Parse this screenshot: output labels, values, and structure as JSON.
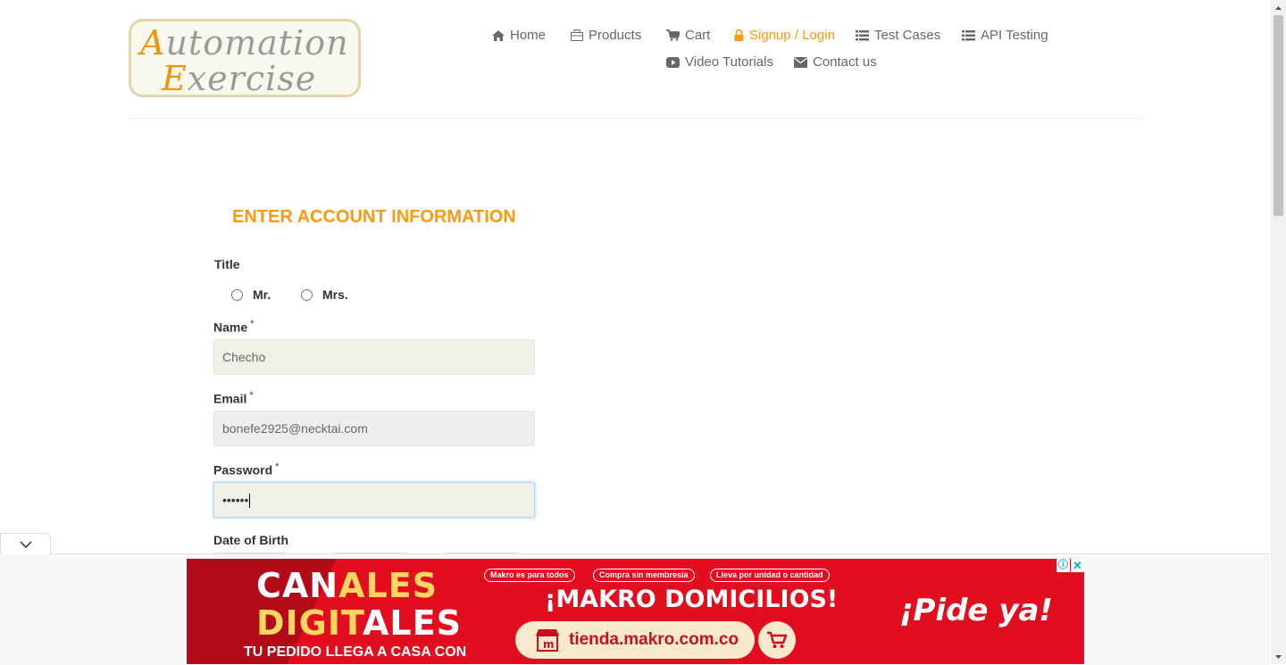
{
  "header": {
    "logo": {
      "first_cap": "A",
      "first_rest": "utomation",
      "second_cap": "E",
      "second_rest": "xercise"
    },
    "nav": [
      {
        "label": "Home",
        "icon": "home-icon"
      },
      {
        "label": "Products",
        "icon": "shopping-bag-icon"
      },
      {
        "label": "Cart",
        "icon": "cart-icon"
      },
      {
        "label": "Signup / Login",
        "icon": "lock-icon",
        "active": true
      },
      {
        "label": "Test Cases",
        "icon": "list-icon"
      },
      {
        "label": "API Testing",
        "icon": "list-icon"
      },
      {
        "label": "Video Tutorials",
        "icon": "youtube-play-icon"
      },
      {
        "label": "Contact us",
        "icon": "envelope-icon"
      }
    ]
  },
  "form": {
    "title": "ENTER ACCOUNT INFORMATION",
    "title_label": "Title",
    "title_options": [
      "Mr.",
      "Mrs."
    ],
    "name_label": "Name",
    "name_value": "Checho",
    "email_label": "Email",
    "email_value": "bonefe2925@necktai.com",
    "password_label": "Password",
    "password_value": "••••••",
    "dob_label": "Date of Birth",
    "required_mark": "*"
  },
  "ad": {
    "line1_white": "CAN",
    "line1_yellow": "ALES",
    "line2_yellow": "DIGIT",
    "line2_white": "ALES",
    "subline": "TU PEDIDO LLEGA A CASA CON",
    "pills": [
      "Makro es para todos",
      "Compra sin membresía",
      "Lleva por unidad o cantidad"
    ],
    "headline": "¡MAKRO DOMICILIOS!",
    "url": "tienda.makro.com.co",
    "cta": "¡Pide ya!",
    "adchoices": "ⓘ",
    "close": "✕"
  },
  "colors": {
    "accent": "#fe980f",
    "text": "#696763",
    "ad_red": "#e20e1f",
    "ad_yellow": "#ffd75e"
  }
}
